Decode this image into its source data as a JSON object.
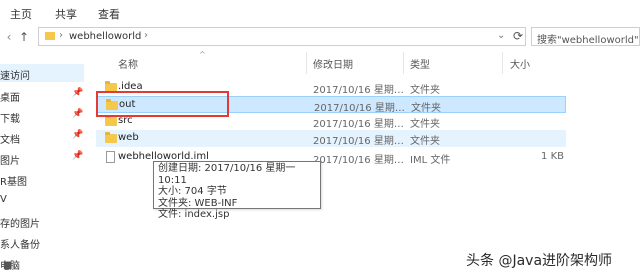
{
  "ribbon": {
    "tabs": [
      "主页",
      "共享",
      "查看"
    ]
  },
  "address": {
    "segment": "webhelloworld"
  },
  "search": {
    "placeholder": "搜索\"webhelloworld\""
  },
  "columns": {
    "name": "名称",
    "date": "修改日期",
    "type": "类型",
    "size": "大小"
  },
  "sidebar": {
    "items": [
      {
        "label": "速访问"
      },
      {
        "label": "桌面"
      },
      {
        "label": "下载"
      },
      {
        "label": "文档"
      },
      {
        "label": "图片"
      },
      {
        "label": "R基图"
      },
      {
        "label": "V"
      },
      {
        "label": "存的图片"
      },
      {
        "label": "系人备份"
      },
      {
        "label": "电脑"
      }
    ]
  },
  "files": [
    {
      "name": ".idea",
      "date": "2017/10/16 星期…",
      "type": "文件夹",
      "size": "",
      "kind": "folder-icon"
    },
    {
      "name": "out",
      "date": "2017/10/16 星期…",
      "type": "文件夹",
      "size": "",
      "kind": "folder-icon"
    },
    {
      "name": "src",
      "date": "2017/10/16 星期…",
      "type": "文件夹",
      "size": "",
      "kind": "folder-icon"
    },
    {
      "name": "web",
      "date": "2017/10/16 星期…",
      "type": "文件夹",
      "size": "",
      "kind": "folder-icon"
    },
    {
      "name": "webhelloworld.iml",
      "date": "2017/10/16 星期…",
      "type": "IML 文件",
      "size": "1 KB",
      "kind": "file-icon"
    }
  ],
  "tooltip": {
    "lines": [
      "创建日期: 2017/10/16 星期一 10:11",
      "大小: 704 字节",
      "文件夹: WEB-INF",
      "文件: index.jsp"
    ]
  },
  "watermark": {
    "text": "头条 @Java进阶架构师"
  },
  "colors": {
    "selection": "#cde8ff",
    "highlight_border": "#e53935",
    "folder": "#f4c84a"
  }
}
